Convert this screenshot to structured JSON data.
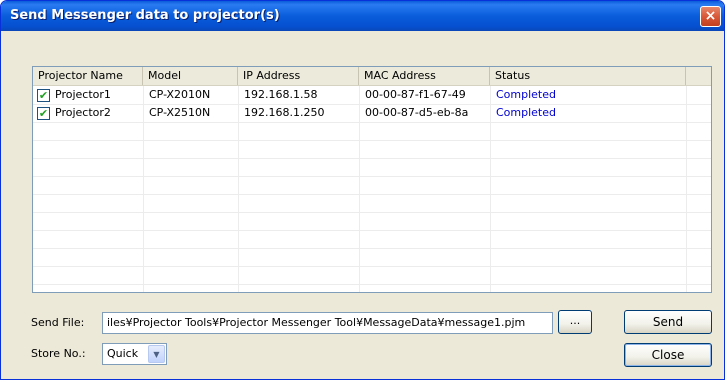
{
  "window": {
    "title": "Send Messenger data to projector(s)",
    "close_symbol": "×"
  },
  "table": {
    "columns": [
      "Projector Name",
      "Model",
      "IP Address",
      "MAC Address",
      "Status"
    ],
    "rows": [
      {
        "checked": true,
        "name": "Projector1",
        "model": "CP-X2010N",
        "ip": "192.168.1.58",
        "mac": "00-00-87-f1-67-49",
        "status": "Completed"
      },
      {
        "checked": true,
        "name": "Projector2",
        "model": "CP-X2510N",
        "ip": "192.168.1.250",
        "mac": "00-00-87-d5-eb-8a",
        "status": "Completed"
      }
    ]
  },
  "send_file": {
    "label": "Send File:",
    "value": "iles¥Projector Tools¥Projector Messenger Tool¥MessageData¥message1.pjm",
    "browse_label": "..."
  },
  "store": {
    "label": "Store No.:",
    "selected": "Quick"
  },
  "buttons": {
    "send": "Send",
    "close": "Close"
  },
  "colors": {
    "status": "#0000d0",
    "titlebar": "#0a5ddb"
  },
  "icons": {
    "checkbox": "checkmark-icon",
    "dropdown": "chevron-down-icon"
  }
}
